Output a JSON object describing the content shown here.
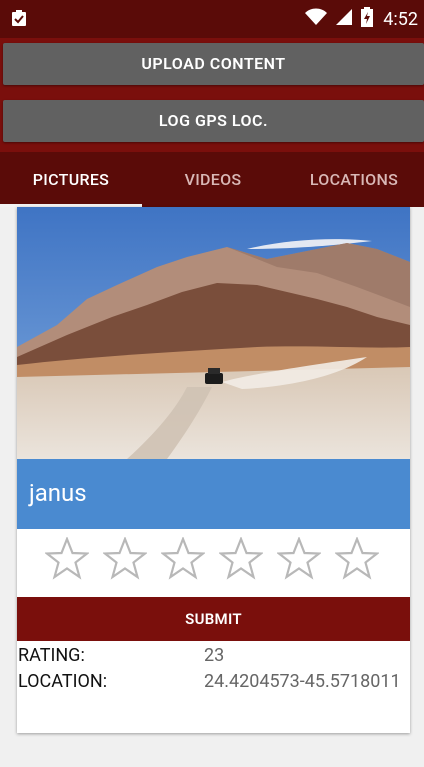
{
  "status_bar": {
    "time": "4:52"
  },
  "actions": {
    "upload_label": "UPLOAD CONTENT",
    "gps_label": "LOG GPS LOC."
  },
  "tabs": [
    {
      "label": "PICTURES",
      "selected": true
    },
    {
      "label": "VIDEOS",
      "selected": false
    },
    {
      "label": "LOCATIONS",
      "selected": false
    }
  ],
  "card": {
    "title": "janus",
    "stars_total": 6,
    "stars_filled": 0,
    "submit_label": "SUBMIT",
    "rating_label": "RATING:",
    "rating_value": "23",
    "location_label": "LOCATION:",
    "location_value": "24.4204573-45.5718011"
  },
  "colors": {
    "primary": "#7a0f0c",
    "dark": "#5a0b08",
    "button_gray": "#616161",
    "title_band": "#4a8ad0"
  }
}
